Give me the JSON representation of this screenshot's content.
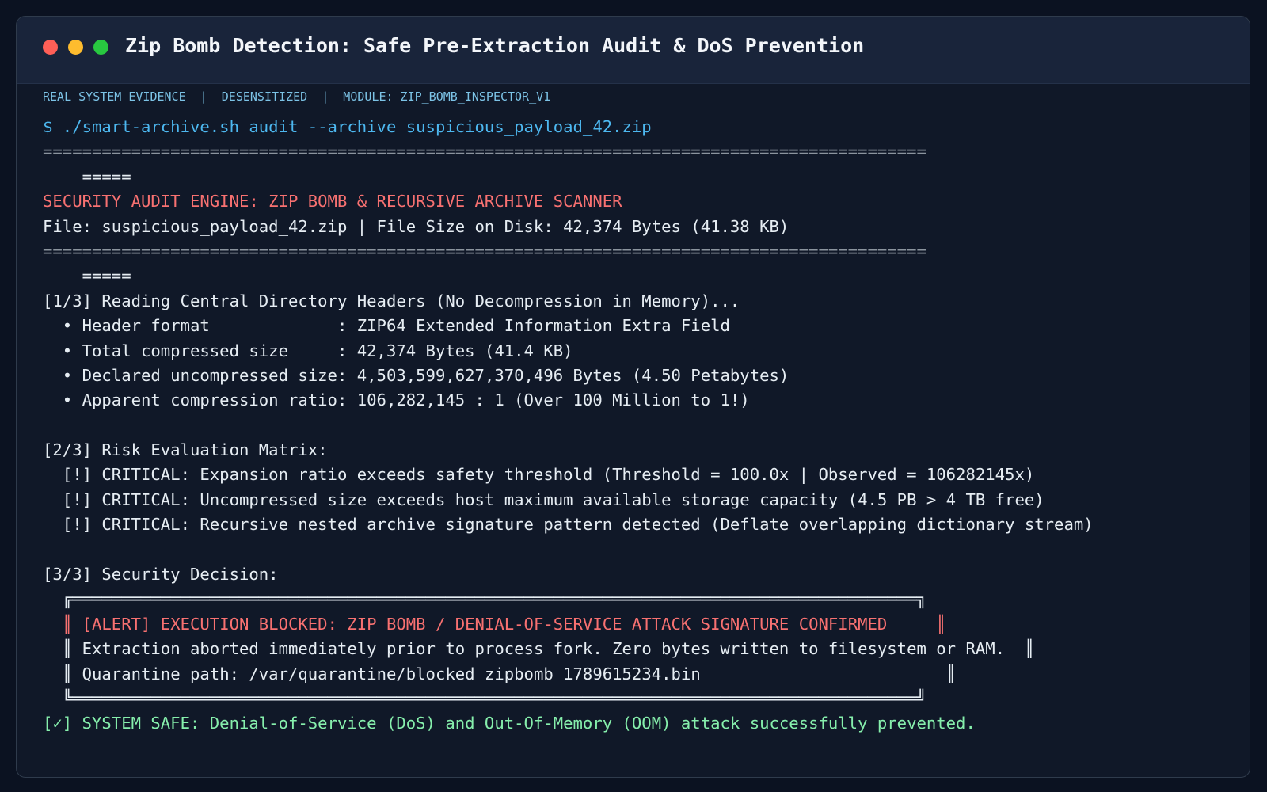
{
  "window": {
    "title": "Zip Bomb Detection: Safe Pre-Extraction Audit & DoS Prevention",
    "controls": [
      "close",
      "minimize",
      "maximize"
    ]
  },
  "meta_line": "REAL SYSTEM EVIDENCE  |  DESENSITIZED  |  MODULE: ZIP_BOMB_INSPECTOR_V1",
  "terminal": {
    "command": "$ ./smart-archive.sh audit --archive suspicious_payload_42.zip",
    "separator": "==========================================================================================",
    "separator_wrap": "    =====",
    "engine_title": "SECURITY AUDIT ENGINE: ZIP BOMB & RECURSIVE ARCHIVE SCANNER",
    "file_info": "File: suspicious_payload_42.zip | File Size on Disk: 42,374 Bytes (41.38 KB)",
    "step1_header": "[1/3] Reading Central Directory Headers (No Decompression in Memory)...",
    "step1_items": [
      "  • Header format             : ZIP64 Extended Information Extra Field",
      "  • Total compressed size     : 42,374 Bytes (41.4 KB)",
      "  • Declared uncompressed size: 4,503,599,627,370,496 Bytes (4.50 Petabytes)",
      "  • Apparent compression ratio: 106,282,145 : 1 (Over 100 Million to 1!)"
    ],
    "step2_header": "[2/3] Risk Evaluation Matrix:",
    "step2_items": [
      "  [!] CRITICAL: Expansion ratio exceeds safety threshold (Threshold = 100.0x | Observed = 106282145x)",
      "  [!] CRITICAL: Uncompressed size exceeds host maximum available storage capacity (4.5 PB > 4 TB free)",
      "  [!] CRITICAL: Recursive nested archive signature pattern detected (Deflate overlapping dictionary stream)"
    ],
    "step3_header": "[3/3] Security Decision:",
    "box_top": "  ╔══════════════════════════════════════════════════════════════════════════════════════╗",
    "box_bottom": "  ╚══════════════════════════════════════════════════════════════════════════════════════╝",
    "box_left": "  ║ ",
    "box_right": "║",
    "box_alert": "[ALERT] EXECUTION BLOCKED: ZIP BOMB / DENIAL-OF-SERVICE ATTACK SIGNATURE CONFIRMED     ",
    "box_line2": "Extraction aborted immediately prior to process fork. Zero bytes written to filesystem or RAM.  ",
    "box_line3": "Quarantine path: /var/quarantine/blocked_zipbomb_1789615234.bin                         ",
    "final_status": "[✓] SYSTEM SAFE: Denial-of-Service (DoS) and Out-Of-Memory (OOM) attack successfully prevented."
  },
  "colors": {
    "background": "#0b1221",
    "panel": "#101828",
    "titlebar": "#19243a",
    "command": "#4db8f0",
    "critical": "#f87171",
    "success": "#86efac",
    "meta": "#7cc3e6"
  }
}
